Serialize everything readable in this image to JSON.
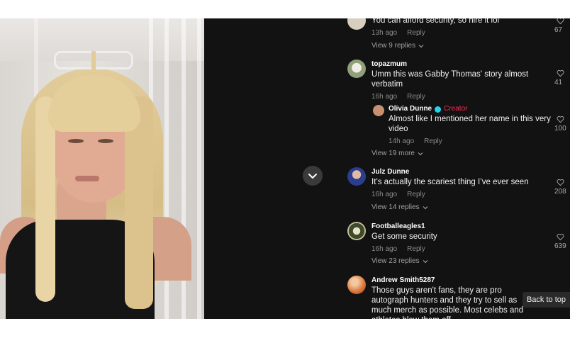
{
  "comments": [
    {
      "text": "You can afford security, so hire it lol",
      "time": "13h ago",
      "reply_label": "Reply",
      "replies_label": "View 9 replies",
      "likes": "67"
    },
    {
      "username": "topazmum",
      "text": "Umm this was Gabby Thomas' story almost verbatim",
      "time": "16h ago",
      "reply_label": "Reply",
      "likes": "41",
      "reply": {
        "username": "Olivia Dunne",
        "creator_label": "Creator",
        "text": "Almost like I mentioned her name in this very video",
        "time": "14h ago",
        "reply_label": "Reply",
        "likes": "100"
      },
      "more_label": "View 19 more"
    },
    {
      "username": "Julz Dunne",
      "text": "It’s actually the scariest thing I’ve ever seen",
      "time": "16h ago",
      "reply_label": "Reply",
      "replies_label": "View 14 replies",
      "likes": "208"
    },
    {
      "username": "Footballeagles1",
      "text": "Get some security",
      "time": "16h ago",
      "reply_label": "Reply",
      "replies_label": "View 23 replies",
      "likes": "639"
    },
    {
      "username": "Andrew Smith5287",
      "text": "Those guys aren't fans, they are pro autograph hunters and they try to sell as much merch as possible. Most celebs and athletes blow them off",
      "likes": ""
    }
  ],
  "back_to_top_label": "Back to top",
  "icons": {
    "scroll": "chevron-down-icon",
    "like": "heart-icon",
    "verified": "verified-badge-icon"
  },
  "colors": {
    "panel_bg": "#121212",
    "creator": "#fe2c55",
    "verified": "#20d5ec",
    "meta": "#8a8a8a"
  }
}
